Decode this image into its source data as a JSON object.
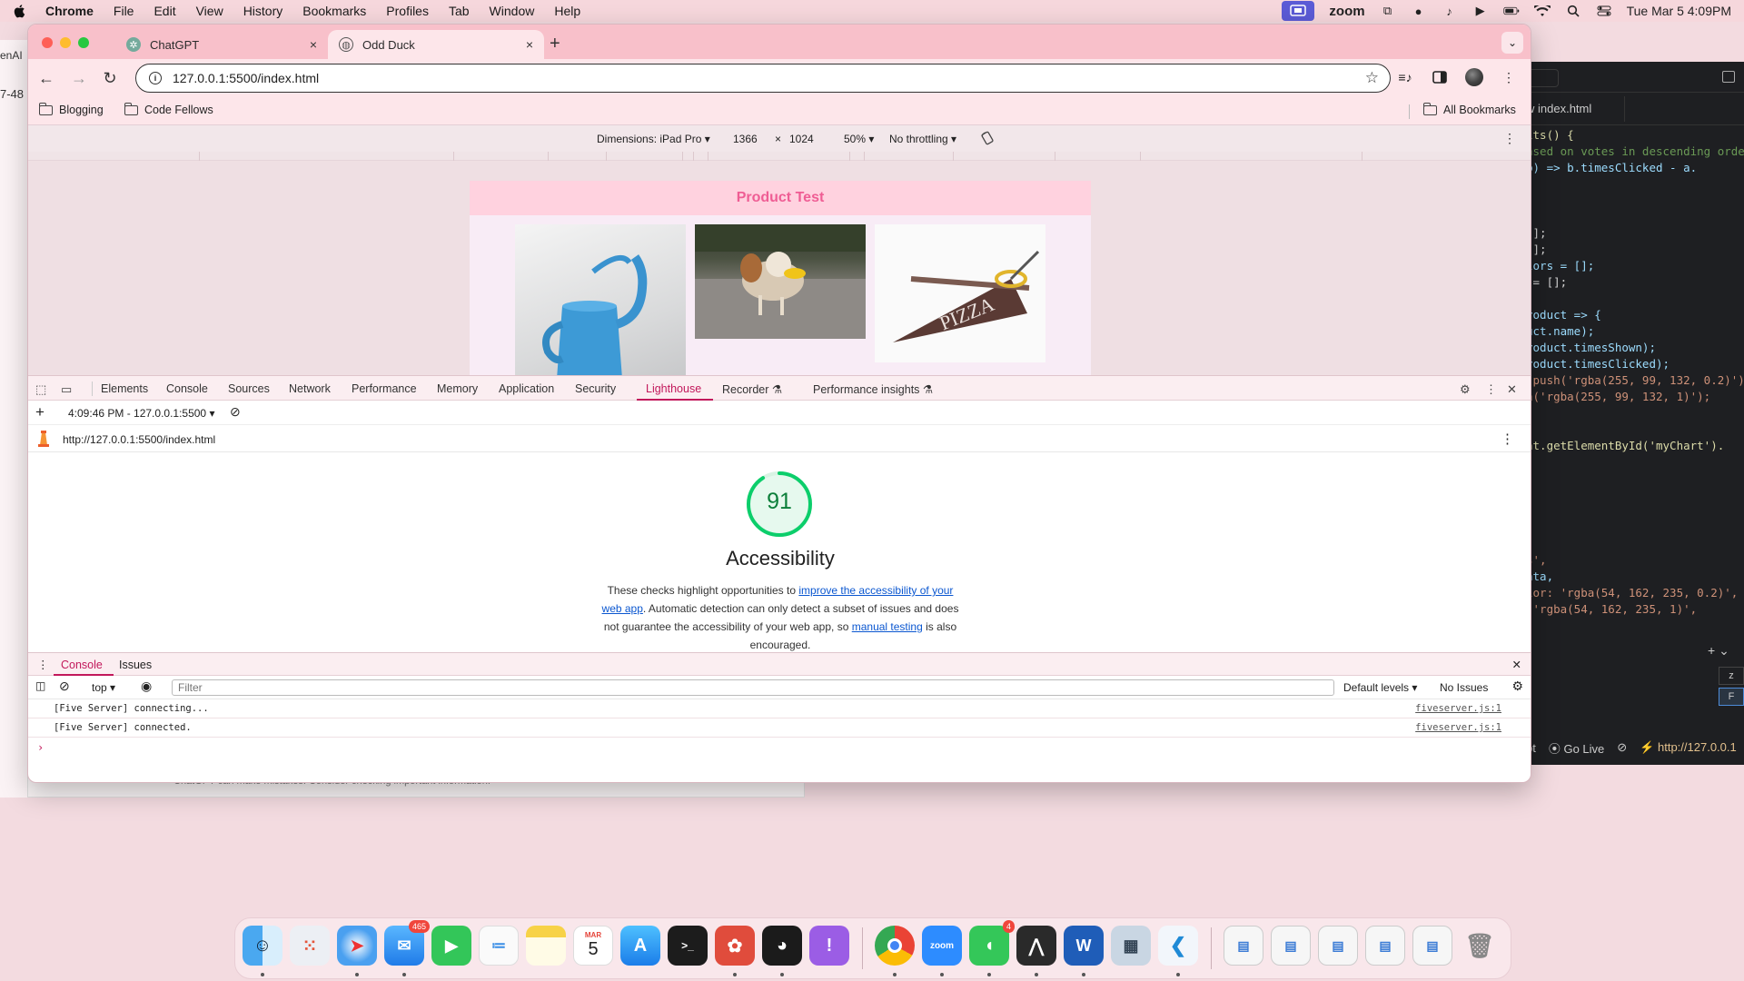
{
  "menubar": {
    "app_name": "Chrome",
    "menus": [
      "File",
      "Edit",
      "View",
      "History",
      "Bookmarks",
      "Profiles",
      "Tab",
      "Window",
      "Help"
    ],
    "zoom_label": "zoom",
    "datetime": "Tue Mar 5  4:09PM"
  },
  "background": {
    "left_window_text_1": "enAI",
    "left_window_text_2": "7-48",
    "chatgpt_disclaimer": "ChatGPT can make mistakes. Consider checking important information."
  },
  "vscode": {
    "tab_label": "w index.html",
    "code_lines": [
      "lts() {",
      "ased on votes in descending order",
      "b) => b.timesClicked - a.",
      "",
      "",
      "",
      "[];",
      "[];",
      "lors = [];",
      " = [];",
      "",
      "roduct => {",
      "uct.name);",
      "roduct.timesShown);",
      "roduct.timesClicked);",
      ".push('rgba(255, 99, 132, 0.2)');",
      "h('rgba(255, 99, 132, 1)');",
      "",
      "",
      "nt.getElementById('myChart').",
      "",
      "",
      "",
      "",
      ",",
      "",
      "s',",
      "ata,",
      "lor: 'rgba(54, 162, 235, 0.2)',",
      " 'rgba(54, 162, 235, 1)',"
    ],
    "terminal_items": [
      "z",
      "F"
    ],
    "status": {
      "lang": "pt",
      "go_live": "Go Live",
      "server_url": "http://127.0.0.1"
    }
  },
  "chrome": {
    "tabs": [
      {
        "title": "ChatGPT",
        "close": "×"
      },
      {
        "title": "Odd Duck",
        "close": "×"
      }
    ],
    "new_tab": "+",
    "url": "127.0.0.1:5500/index.html",
    "bookmarks": [
      "Blogging",
      "Code Fellows"
    ],
    "all_bookmarks": "All Bookmarks"
  },
  "device_toolbar": {
    "dimensions_label": "Dimensions: iPad Pro ▾",
    "width": "1366",
    "times": "×",
    "height": "1024",
    "zoom": "50% ▾",
    "throttling": "No throttling ▾"
  },
  "page": {
    "title": "Product Test"
  },
  "devtools": {
    "tabs": [
      "Elements",
      "Console",
      "Sources",
      "Network",
      "Performance",
      "Memory",
      "Application",
      "Security",
      "Lighthouse",
      "Recorder",
      "Performance insights"
    ],
    "active_tab": "Lighthouse",
    "report_selector": "4:09:46 PM - 127.0.0.1:5500 ▾",
    "report_url": "http://127.0.0.1:5500/index.html",
    "lighthouse": {
      "score": "91",
      "score_fraction": 0.91,
      "score_color": "#0cce6b",
      "category": "Accessibility",
      "desc_1": "These checks highlight opportunities to ",
      "desc_link_1": "improve the accessibility of your web app",
      "desc_2": ". Automatic detection can only detect a subset of issues and does not guarantee the accessibility of your web app, so ",
      "desc_link_2": "manual testing",
      "desc_3": " is also encouraged."
    }
  },
  "console": {
    "drawer_tabs": [
      "Console",
      "Issues"
    ],
    "context": "top ▾",
    "filter_placeholder": "Filter",
    "levels": "Default levels ▾",
    "issues": "No Issues",
    "messages": [
      {
        "text": "[Five Server] connecting...",
        "source": "fiveserver.js:1"
      },
      {
        "text": "[Five Server] connected.",
        "source": "fiveserver.js:1"
      }
    ],
    "prompt": "›"
  },
  "dock": {
    "mail_badge": "465",
    "messages_badge": "4",
    "calendar_month": "MAR",
    "calendar_day": "5",
    "zoom_label": "zoom"
  }
}
